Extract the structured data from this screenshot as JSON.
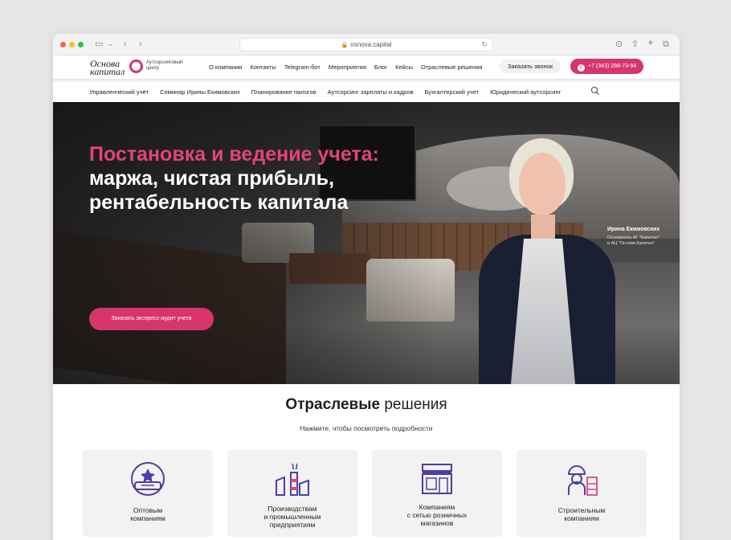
{
  "browser": {
    "url": "osnova.capital",
    "back_icon": "chevron-left-icon",
    "forward_icon": "chevron-right-icon"
  },
  "header": {
    "logo_line1": "Основа",
    "logo_line2": "капитал",
    "logo_sub": "Аутсорсинговый центр",
    "nav": [
      "О компании",
      "Контакты",
      "Telegram-бот",
      "Мероприятия",
      "Блог",
      "Кейсы",
      "Отраслевые решения"
    ],
    "call_button": "Заказать звонок",
    "phone": "+7 (343) 288-73-94",
    "subnav": [
      "Управленческий учёт",
      "Семинар Ирины Екимовских",
      "Планирование налогов",
      "Аутсорсинг зарплаты и кадров",
      "Бухгалтерский учет",
      "Юридический аутсорсинг"
    ]
  },
  "hero": {
    "title_pink": "Постановка и ведение учета:",
    "title_line2": "маржа, чистая прибыль,",
    "title_line3": "рентабельность капитала",
    "cta": "Заказать экспресс-аудит учета",
    "person_name": "Ирина Екимовских",
    "person_role_1": "Основатель АГ \"Капитал\"",
    "person_role_2": "и АЦ \"Основа Капитал\""
  },
  "industries": {
    "title_bold": "Отраслевые",
    "title_rest": "решения",
    "subtitle": "Нажмите, чтобы посмотреть подробности",
    "cards": [
      {
        "label_1": "Оптовым",
        "label_2": "компаниям",
        "icon": "wholesale-icon"
      },
      {
        "label_1": "Производствам",
        "label_2": "и промышленным",
        "label_3": "предприятиям",
        "icon": "factory-icon"
      },
      {
        "label_1": "Компаниям",
        "label_2": "с сетью розничных",
        "label_3": "магазинов",
        "icon": "store-icon"
      },
      {
        "label_1": "Строительным",
        "label_2": "компаниям",
        "icon": "construction-icon"
      }
    ]
  },
  "colors": {
    "accent": "#d8356d",
    "accent_text": "#e2437c",
    "icon": "#4a3fa3"
  }
}
